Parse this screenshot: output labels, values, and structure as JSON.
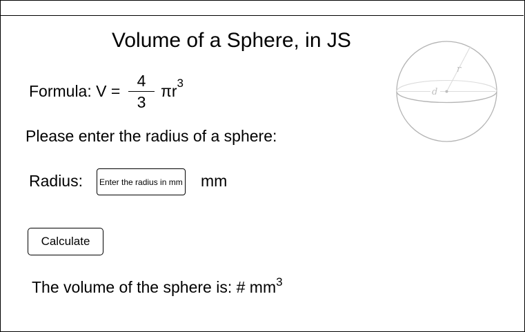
{
  "page": {
    "title": "Volume of a Sphere, in JS"
  },
  "formula": {
    "label": "Formula: V =",
    "numerator": "4",
    "denominator": "3",
    "pi_r": "πr",
    "exponent": "3"
  },
  "prompt": "Please enter the radius of a sphere:",
  "radius": {
    "label": "Radius:",
    "placeholder": "Enter the radius in mm",
    "value": "",
    "unit": "mm"
  },
  "calculate_button": {
    "label": "Calculate"
  },
  "result": {
    "text": "The volume of the sphere is: # mm",
    "exponent": "3"
  },
  "sphere_diagram": {
    "radius_label": "r",
    "diameter_label": "d",
    "outline_color": "#b3b3b3",
    "label_color": "#c0c0c0"
  }
}
